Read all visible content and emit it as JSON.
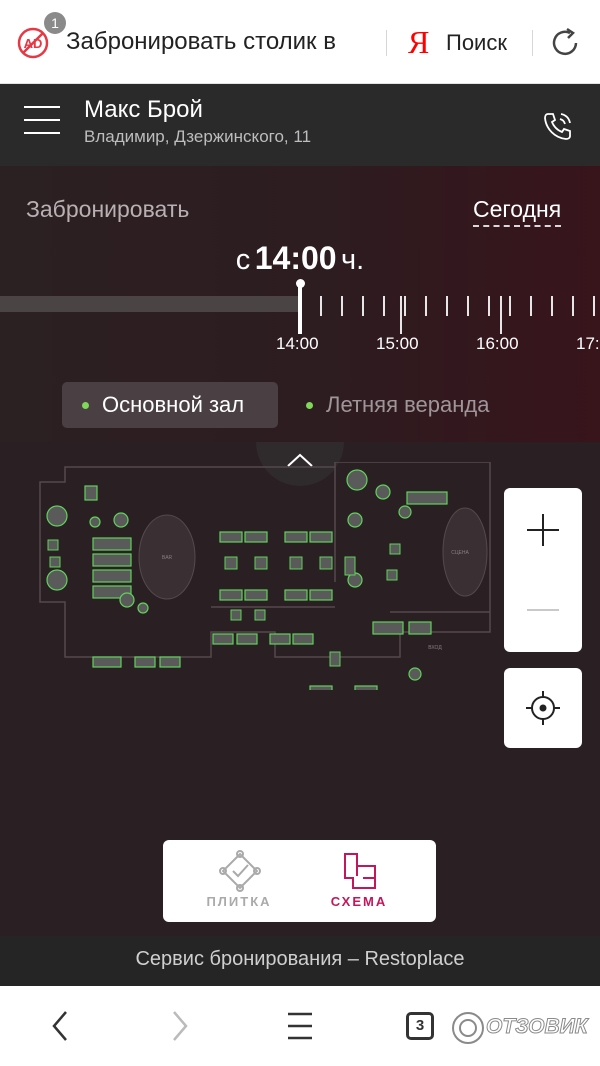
{
  "browser": {
    "adblock_count": "1",
    "page_title": "Забронировать столик в",
    "yandex_logo": "Я",
    "search_label": "Поиск"
  },
  "restaurant": {
    "name": "Макс Брой",
    "address": "Владимир, Дзержинского, 11"
  },
  "booking": {
    "label": "Забронировать",
    "date_link": "Сегодня",
    "time_prefix": "с",
    "time_value": "14:00",
    "time_suffix": "ч.",
    "timeline_labels": [
      "14:00",
      "15:00",
      "16:00",
      "17:"
    ],
    "halls": [
      {
        "label": "Основной зал",
        "active": true
      },
      {
        "label": "Летняя веранда",
        "active": false
      }
    ]
  },
  "view_switch": {
    "tiles_label": "ПЛИТКА",
    "scheme_label": "СХЕМА",
    "active": "scheme"
  },
  "footer": {
    "text": "Сервис бронирования – Restoplace"
  },
  "bottom_nav": {
    "tabs_count": "3",
    "watermark": "ОТЗОВИК"
  },
  "colors": {
    "accent": "#c2185b",
    "available_dot": "#7ed957",
    "table_outline": "#5fd35a",
    "yandex_red": "#ff0000"
  }
}
